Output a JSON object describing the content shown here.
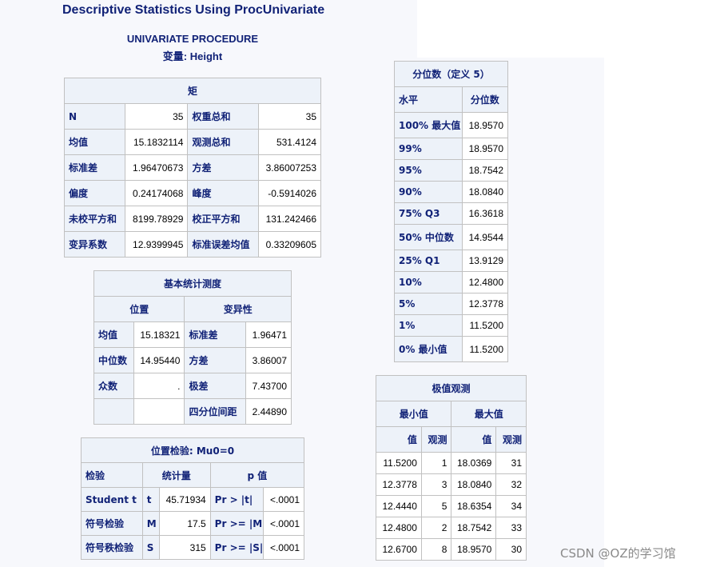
{
  "page_title": "Descriptive Statistics Using ProcUnivariate",
  "procedure": "UNIVARIATE PROCEDURE",
  "variable_line": "变量: Height",
  "moments": {
    "caption": "矩",
    "rows": [
      [
        "N",
        "35",
        "权重总和",
        "35"
      ],
      [
        "均值",
        "15.1832114",
        "观测总和",
        "531.4124"
      ],
      [
        "标准差",
        "1.96470673",
        "方差",
        "3.86007253"
      ],
      [
        "偏度",
        "0.24174068",
        "峰度",
        "-0.5914026"
      ],
      [
        "未校平方和",
        "8199.78929",
        "校正平方和",
        "131.242466"
      ],
      [
        "变异系数",
        "12.9399945",
        "标准误差均值",
        "0.33209605"
      ]
    ]
  },
  "basic": {
    "caption": "基本统计测度",
    "col1": "位置",
    "col2": "变异性",
    "rows": [
      [
        "均值",
        "15.18321",
        "标准差",
        "1.96471"
      ],
      [
        "中位数",
        "14.95440",
        "方差",
        "3.86007"
      ],
      [
        "众数",
        ".",
        "极差",
        "7.43700"
      ],
      [
        "",
        "",
        "四分位间距",
        "2.44890"
      ]
    ]
  },
  "location_test": {
    "caption": "位置检验: Mu0=0",
    "headers": [
      "检验",
      "统计量",
      "p 值"
    ],
    "rows": [
      [
        "Student t",
        "t",
        "45.71934",
        "Pr > |t|",
        "<.0001"
      ],
      [
        "符号检验",
        "M",
        "17.5",
        "Pr >= |M|",
        "<.0001"
      ],
      [
        "符号秩检验",
        "S",
        "315",
        "Pr >= |S|",
        "<.0001"
      ]
    ]
  },
  "quantiles": {
    "caption": "分位数（定义 5）",
    "headers": [
      "水平",
      "分位数"
    ],
    "rows": [
      [
        "100% 最大值",
        "18.9570"
      ],
      [
        "99%",
        "18.9570"
      ],
      [
        "95%",
        "18.7542"
      ],
      [
        "90%",
        "18.0840"
      ],
      [
        "75% Q3",
        "16.3618"
      ],
      [
        "50% 中位数",
        "14.9544"
      ],
      [
        "25% Q1",
        "13.9129"
      ],
      [
        "10%",
        "12.4800"
      ],
      [
        "5%",
        "12.3778"
      ],
      [
        "1%",
        "11.5200"
      ],
      [
        "0% 最小值",
        "11.5200"
      ]
    ]
  },
  "extremes": {
    "caption": "极值观测",
    "min_header": "最小值",
    "max_header": "最大值",
    "sub_headers": [
      "值",
      "观测",
      "值",
      "观测"
    ],
    "rows": [
      [
        "11.5200",
        "1",
        "18.0369",
        "31"
      ],
      [
        "12.3778",
        "3",
        "18.0840",
        "32"
      ],
      [
        "12.4440",
        "5",
        "18.6354",
        "34"
      ],
      [
        "12.4800",
        "2",
        "18.7542",
        "33"
      ],
      [
        "12.6700",
        "8",
        "18.9570",
        "30"
      ]
    ]
  },
  "watermark": "CSDN @OZ的学习馆"
}
